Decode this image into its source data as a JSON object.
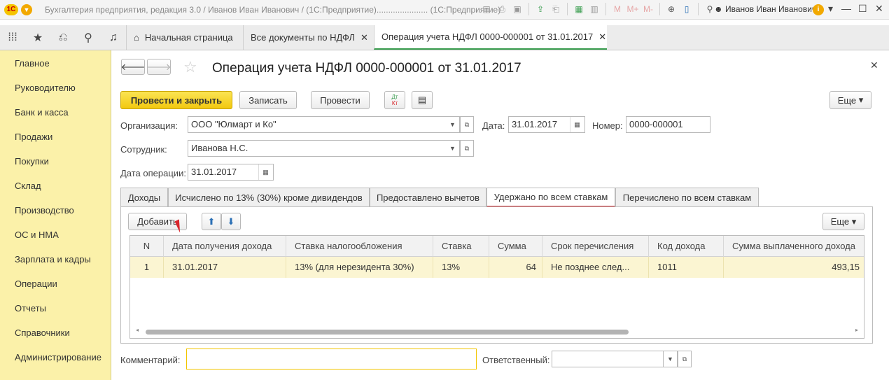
{
  "window": {
    "logo": "1С",
    "title": "Бухгалтерия предприятия, редакция 3.0 / Иванов Иван Иванович / (1С:Предприятие)...................... (1С:Предприятие)",
    "user": "Иванов Иван Иванович",
    "toolbar_icons": [
      "save-icon",
      "print-icon",
      "preview-icon",
      "upload-icon",
      "print2-icon",
      "calculator-icon",
      "calendar-icon",
      "m-icon",
      "m-plus-icon",
      "m-minus-icon",
      "zoom-icon",
      "panel-icon",
      "tools-icon"
    ],
    "toolbar_glyphs": {
      "m": "M",
      "m_plus": "M+",
      "m_minus": "M-",
      "info": "i"
    }
  },
  "tabs": [
    {
      "label": "Начальная страница",
      "closable": false
    },
    {
      "label": "Все документы по НДФЛ",
      "closable": true
    },
    {
      "label": "Операция учета НДФЛ 0000-000001 от 31.01.2017",
      "closable": true,
      "active": true
    }
  ],
  "sidebar": {
    "items": [
      "Главное",
      "Руководителю",
      "Банк и касса",
      "Продажи",
      "Покупки",
      "Склад",
      "Производство",
      "ОС и НМА",
      "Зарплата и кадры",
      "Операции",
      "Отчеты",
      "Справочники",
      "Администрирование"
    ]
  },
  "form": {
    "title": "Операция учета НДФЛ 0000-000001 от 31.01.2017",
    "buttons": {
      "post_close": "Провести и закрыть",
      "save": "Записать",
      "post": "Провести",
      "more": "Еще",
      "dtkt_dt": "Дт",
      "dtkt_kt": "Кт"
    },
    "organization": {
      "label": "Организация:",
      "value": "ООО \"Юлмарт и Ко\""
    },
    "date": {
      "label": "Дата:",
      "value": "31.01.2017"
    },
    "number": {
      "label": "Номер:",
      "value": "0000-000001"
    },
    "employee": {
      "label": "Сотрудник:",
      "value": "Иванова Н.С."
    },
    "op_date": {
      "label": "Дата операции:",
      "value": "31.01.2017"
    },
    "comment": {
      "label": "Комментарий:",
      "value": ""
    },
    "responsible": {
      "label": "Ответственный:",
      "value": ""
    }
  },
  "subtabs": [
    {
      "label": "Доходы"
    },
    {
      "label": "Исчислено по 13% (30%) кроме дивидендов"
    },
    {
      "label": "Предоставлено вычетов"
    },
    {
      "label": "Удержано по всем ставкам",
      "active": true
    },
    {
      "label": "Перечислено по всем ставкам"
    }
  ],
  "table_panel": {
    "add_button": "Добавить",
    "more_button": "Еще",
    "columns": [
      "N",
      "Дата получения дохода",
      "Ставка налогообложения",
      "Ставка",
      "Сумма",
      "Срок перечисления",
      "Код дохода",
      "Сумма выплаченного дохода"
    ],
    "rows": [
      [
        "1",
        "31.01.2017",
        "13% (для нерезидента 30%)",
        "13%",
        "64",
        "Не позднее след...",
        "1011",
        "493,15"
      ]
    ]
  },
  "colors": {
    "sidebar_bg": "#fbf1a9",
    "primary_button": "#f2c80f",
    "active_tab_underline": "#3a9d4f",
    "active_subtab_underline": "#d9262c",
    "selected_row": "#fbf5d2"
  }
}
